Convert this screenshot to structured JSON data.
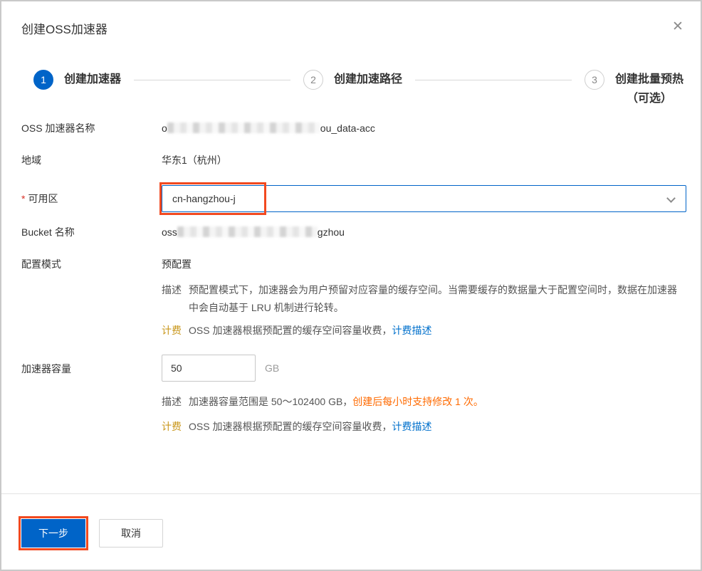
{
  "dialog": {
    "title": "创建OSS加速器",
    "close_glyph": "✕"
  },
  "steps": [
    {
      "number": "1",
      "label": "创建加速器",
      "state": "active"
    },
    {
      "number": "2",
      "label": "创建加速路径",
      "state": "inactive"
    },
    {
      "number": "3",
      "label": "创建批量预热",
      "label2": "（可选）",
      "state": "inactive"
    }
  ],
  "form": {
    "name": {
      "label": "OSS 加速器名称",
      "visible_prefix": "o",
      "visible_suffix": "ou_data-acc",
      "redacted": true
    },
    "region": {
      "label": "地域",
      "value": "华东1（杭州）"
    },
    "zone": {
      "required_mark": "*",
      "label": "可用区",
      "value": "cn-hangzhou-j"
    },
    "bucket": {
      "label": "Bucket 名称",
      "visible_prefix": "oss",
      "visible_suffix": "gzhou",
      "redacted": true
    },
    "config_mode": {
      "label": "配置模式",
      "value": "预配置",
      "desc_tag": "描述",
      "desc_text": "预配置模式下，加速器会为用户预留对应容量的缓存空间。当需要缓存的数据量大于配置空间时，数据在加速器中会自动基于 LRU 机制进行轮转。",
      "billing_tag": "计费",
      "billing_text": "OSS 加速器根据预配置的缓存空间容量收费，",
      "billing_link": "计费描述"
    },
    "capacity": {
      "label": "加速器容量",
      "value": "50",
      "unit": "GB",
      "desc_tag": "描述",
      "desc_text": "加速器容量范围是 50～102400 GB，",
      "desc_highlight": "创建后每小时支持修改 1 次。",
      "billing_tag": "计费",
      "billing_text": "OSS 加速器根据预配置的缓存空间容量收费，",
      "billing_link": "计费描述"
    }
  },
  "footer": {
    "next_label": "下一步",
    "cancel_label": "取消"
  },
  "colors": {
    "accent_blue": "#0064c8",
    "link_blue": "#0070cc",
    "annotation_orange": "#f2491f",
    "warn_orange": "#ff6a00",
    "billing_gold": "#c9971c"
  }
}
